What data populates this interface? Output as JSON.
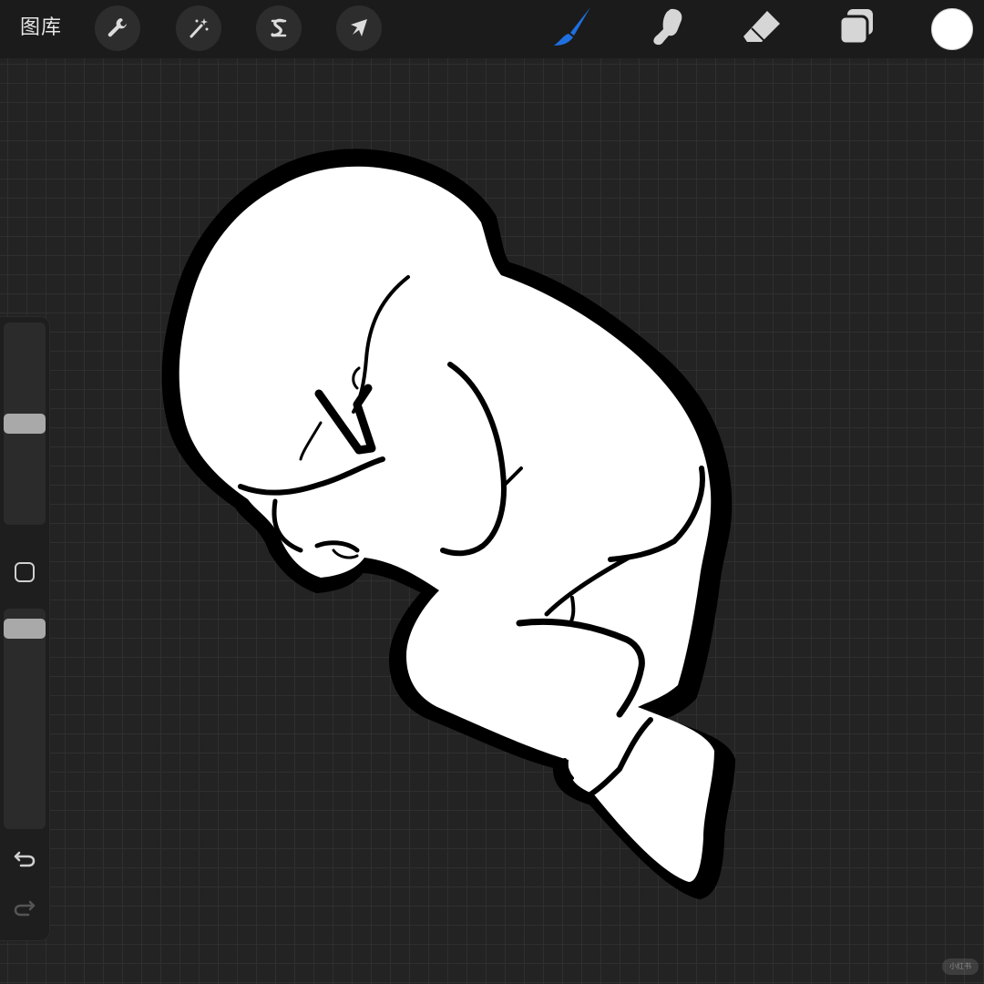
{
  "app": {
    "gallery_label": "图库"
  },
  "toolbar_left": [
    {
      "name": "actions",
      "icon": "wrench-icon"
    },
    {
      "name": "adjustments",
      "icon": "magic-wand-icon"
    },
    {
      "name": "selection",
      "icon": "selection-s-icon"
    },
    {
      "name": "transform",
      "icon": "arrow-cursor-icon"
    }
  ],
  "toolbar_right": [
    {
      "name": "brush",
      "icon": "brush-icon",
      "active": true
    },
    {
      "name": "smudge",
      "icon": "smudge-finger-icon",
      "active": false
    },
    {
      "name": "eraser",
      "icon": "eraser-icon",
      "active": false
    },
    {
      "name": "layers",
      "icon": "layers-icon",
      "active": false
    }
  ],
  "colors": {
    "accent": "#1e6fe0",
    "current_color": "#ffffff",
    "toolbar_bg": "#1b1b1b",
    "canvas_bg": "#232323"
  },
  "sidebar": {
    "brush_size": 0.5,
    "brush_opacity": 0.95,
    "modify_icon": "square-icon",
    "undo_icon": "undo-icon",
    "redo_icon": "redo-icon"
  },
  "watermark": "小红书"
}
